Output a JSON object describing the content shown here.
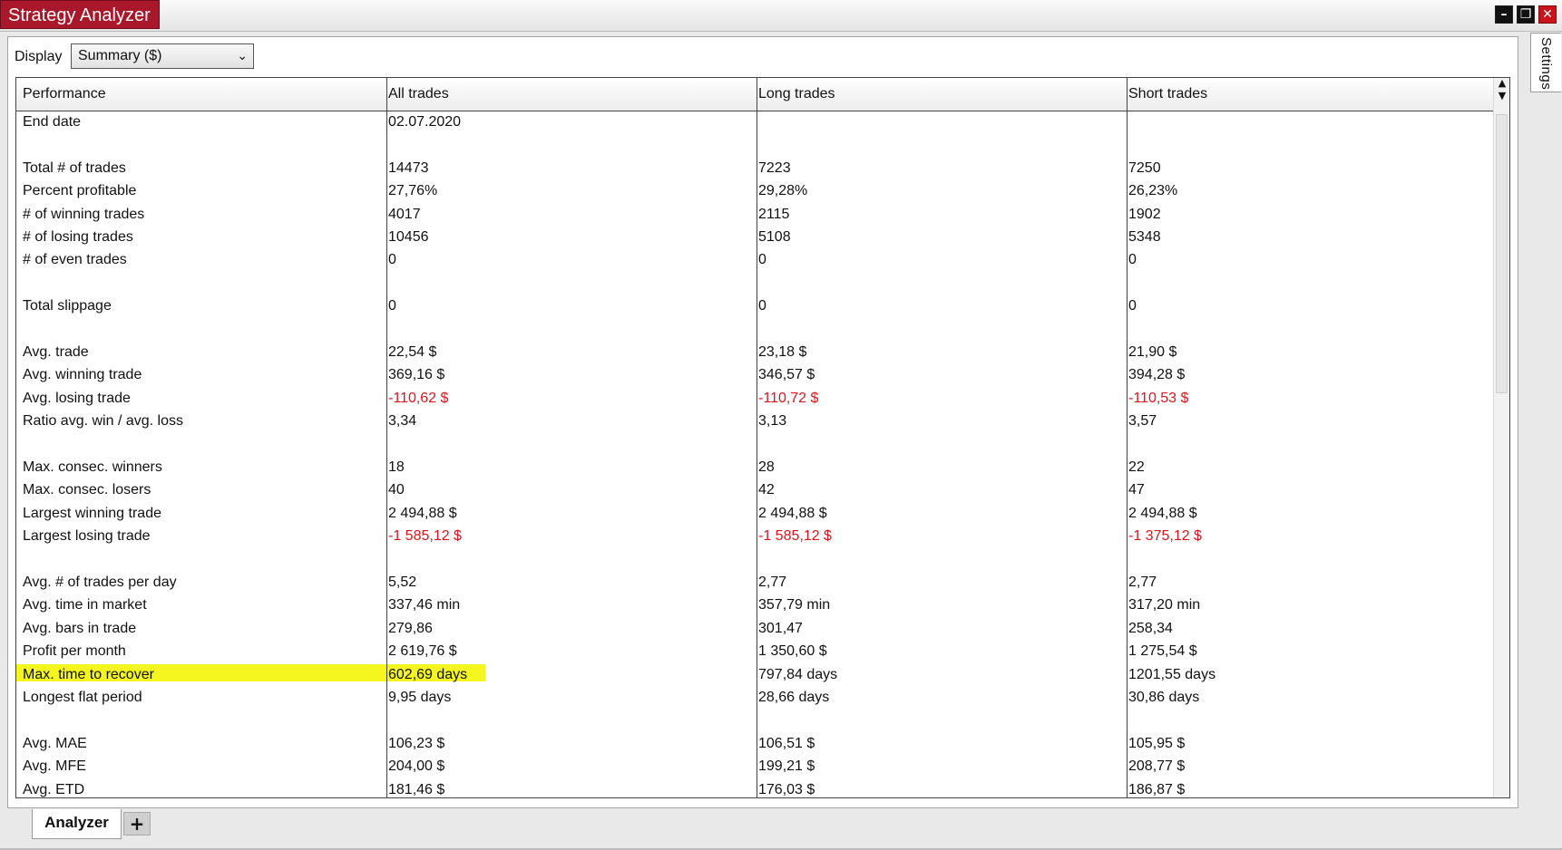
{
  "window": {
    "title": "Strategy Analyzer",
    "settings_tab": "Settings",
    "buttons": {
      "minimize": "–",
      "restore": "❐",
      "close": "✕"
    }
  },
  "display": {
    "label": "Display",
    "selected": "Summary ($)"
  },
  "table": {
    "columns": [
      "Performance",
      "All trades",
      "Long trades",
      "Short trades"
    ],
    "rows": [
      {
        "label": "End date",
        "all": "02.07.2020",
        "long": "",
        "short": ""
      },
      {
        "label": "",
        "all": "",
        "long": "",
        "short": ""
      },
      {
        "label": "Total # of trades",
        "all": "14473",
        "long": "7223",
        "short": "7250"
      },
      {
        "label": "Percent profitable",
        "all": "27,76%",
        "long": "29,28%",
        "short": "26,23%"
      },
      {
        "label": "# of winning trades",
        "all": "4017",
        "long": "2115",
        "short": "1902"
      },
      {
        "label": "# of losing trades",
        "all": "10456",
        "long": "5108",
        "short": "5348"
      },
      {
        "label": "# of even trades",
        "all": "0",
        "long": "0",
        "short": "0"
      },
      {
        "label": "",
        "all": "",
        "long": "",
        "short": ""
      },
      {
        "label": "Total slippage",
        "all": "0",
        "long": "0",
        "short": "0"
      },
      {
        "label": "",
        "all": "",
        "long": "",
        "short": ""
      },
      {
        "label": "Avg. trade",
        "all": "22,54 $",
        "long": "23,18 $",
        "short": "21,90 $"
      },
      {
        "label": "Avg. winning trade",
        "all": "369,16 $",
        "long": "346,57 $",
        "short": "394,28 $"
      },
      {
        "label": "Avg. losing trade",
        "all": "-110,62 $",
        "long": "-110,72 $",
        "short": "-110,53 $",
        "negative": true
      },
      {
        "label": "Ratio avg. win / avg. loss",
        "all": "3,34",
        "long": "3,13",
        "short": "3,57"
      },
      {
        "label": "",
        "all": "",
        "long": "",
        "short": ""
      },
      {
        "label": "Max. consec. winners",
        "all": "18",
        "long": "28",
        "short": "22"
      },
      {
        "label": "Max. consec. losers",
        "all": "40",
        "long": "42",
        "short": "47"
      },
      {
        "label": "Largest winning trade",
        "all": "2 494,88 $",
        "long": "2 494,88 $",
        "short": "2 494,88 $"
      },
      {
        "label": "Largest losing trade",
        "all": "-1 585,12 $",
        "long": "-1 585,12 $",
        "short": "-1 375,12 $",
        "negative": true
      },
      {
        "label": "",
        "all": "",
        "long": "",
        "short": ""
      },
      {
        "label": "Avg. # of trades per day",
        "all": "5,52",
        "long": "2,77",
        "short": "2,77"
      },
      {
        "label": "Avg. time in market",
        "all": "337,46 min",
        "long": "357,79 min",
        "short": "317,20 min"
      },
      {
        "label": "Avg. bars in trade",
        "all": "279,86",
        "long": "301,47",
        "short": "258,34"
      },
      {
        "label": "Profit per month",
        "all": "2 619,76 $",
        "long": "1 350,60 $",
        "short": "1 275,54 $"
      },
      {
        "label": "Max. time to recover",
        "all": "602,69 days",
        "long": "797,84 days",
        "short": "1201,55 days",
        "highlight": true
      },
      {
        "label": "Longest flat period",
        "all": "9,95 days",
        "long": "28,66 days",
        "short": "30,86 days"
      },
      {
        "label": "",
        "all": "",
        "long": "",
        "short": ""
      },
      {
        "label": "Avg. MAE",
        "all": "106,23 $",
        "long": "106,51 $",
        "short": "105,95 $"
      },
      {
        "label": "Avg. MFE",
        "all": "204,00 $",
        "long": "199,21 $",
        "short": "208,77 $"
      },
      {
        "label": "Avg. ETD",
        "all": "181,46 $",
        "long": "176,03 $",
        "short": "186,87 $"
      }
    ],
    "highlight_color": "#f5f520",
    "negative_color": "#e0141c"
  },
  "bottom_tabs": {
    "active": "Analyzer",
    "add": "+"
  }
}
